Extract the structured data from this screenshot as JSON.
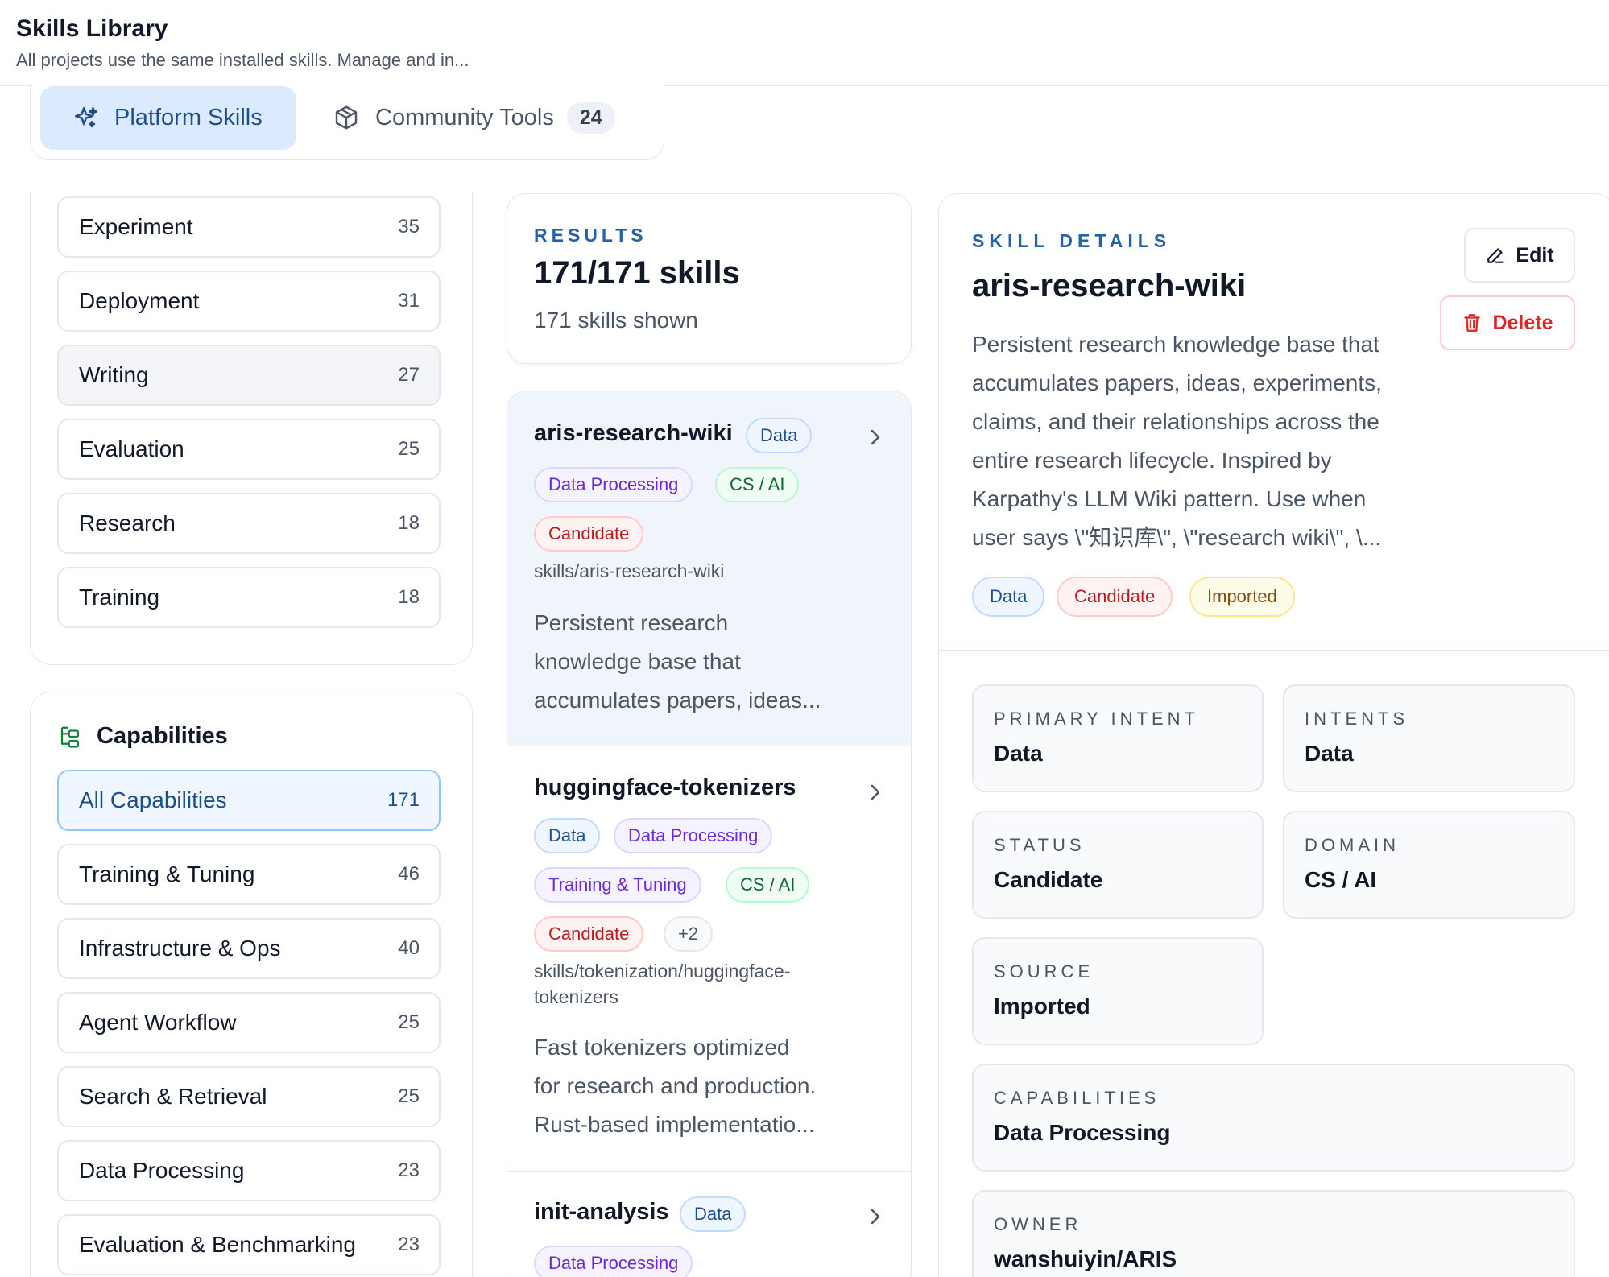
{
  "header": {
    "title": "Skills Library",
    "subtitle": "All projects use the same installed skills. Manage and in..."
  },
  "tabs": {
    "platform": {
      "label": "Platform Skills",
      "icon": "sparkles-icon"
    },
    "community": {
      "label": "Community Tools",
      "icon": "cube-icon",
      "count": "24"
    }
  },
  "categories": [
    {
      "label": "Experiment",
      "count": "35"
    },
    {
      "label": "Deployment",
      "count": "31"
    },
    {
      "label": "Writing",
      "count": "27"
    },
    {
      "label": "Evaluation",
      "count": "25"
    },
    {
      "label": "Research",
      "count": "18"
    },
    {
      "label": "Training",
      "count": "18"
    }
  ],
  "capabilities": {
    "heading": "Capabilities",
    "icon": "tree-structure-icon",
    "items": [
      {
        "label": "All Capabilities",
        "count": "171"
      },
      {
        "label": "Training & Tuning",
        "count": "46"
      },
      {
        "label": "Infrastructure & Ops",
        "count": "40"
      },
      {
        "label": "Agent Workflow",
        "count": "25"
      },
      {
        "label": "Search & Retrieval",
        "count": "25"
      },
      {
        "label": "Data Processing",
        "count": "23"
      },
      {
        "label": "Evaluation & Benchmarking",
        "count": "23"
      }
    ]
  },
  "results": {
    "eyebrow": "RESULTS",
    "count": "171/171 skills",
    "shown": "171 skills shown"
  },
  "skills": [
    {
      "name": "aris-research-wiki",
      "tags": [
        "Data",
        "Data Processing",
        "CS / AI",
        "Candidate"
      ],
      "path": "skills/aris-research-wiki",
      "desc_lines": [
        "Persistent research",
        "knowledge base that",
        "accumulates papers, ideas..."
      ]
    },
    {
      "name": "huggingface-tokenizers",
      "tags": [
        "Data",
        "Data Processing",
        "Training & Tuning",
        "CS / AI",
        "Candidate",
        "+2"
      ],
      "path_lines": [
        "skills/tokenization/huggingface-",
        "tokenizers"
      ],
      "desc_lines": [
        "Fast tokenizers optimized",
        "for research and production.",
        "Rust-based implementatio..."
      ]
    },
    {
      "name": "init-analysis",
      "tags": [
        "Data",
        "Data Processing"
      ]
    }
  ],
  "detail": {
    "eyebrow": "SKILL DETAILS",
    "name": "aris-research-wiki",
    "desc_lines": [
      "Persistent research knowledge base that",
      "accumulates papers, ideas, experiments,",
      "claims, and their relationships across the",
      "entire research lifecycle. Inspired by",
      "Karpathy's LLM Wiki pattern. Use when",
      "user says \\\"知识库\\\", \\\"research wiki\\\", \\..."
    ],
    "edit_label": "Edit",
    "delete_label": "Delete",
    "badges": [
      "Data",
      "Candidate",
      "Imported"
    ],
    "fields": {
      "primary_intent": {
        "label": "PRIMARY INTENT",
        "value": "Data"
      },
      "intents": {
        "label": "INTENTS",
        "value": "Data"
      },
      "status": {
        "label": "STATUS",
        "value": "Candidate"
      },
      "domain": {
        "label": "DOMAIN",
        "value": "CS / AI"
      },
      "source": {
        "label": "SOURCE",
        "value": "Imported"
      },
      "capabilities": {
        "label": "CAPABILITIES",
        "value": "Data Processing"
      },
      "owner": {
        "label": "OWNER",
        "value": "wanshuiyin/ARIS"
      }
    }
  },
  "colors": {
    "accent": "#2563a8",
    "active_tab_bg": "#dbeafe",
    "danger": "#dc2626"
  }
}
